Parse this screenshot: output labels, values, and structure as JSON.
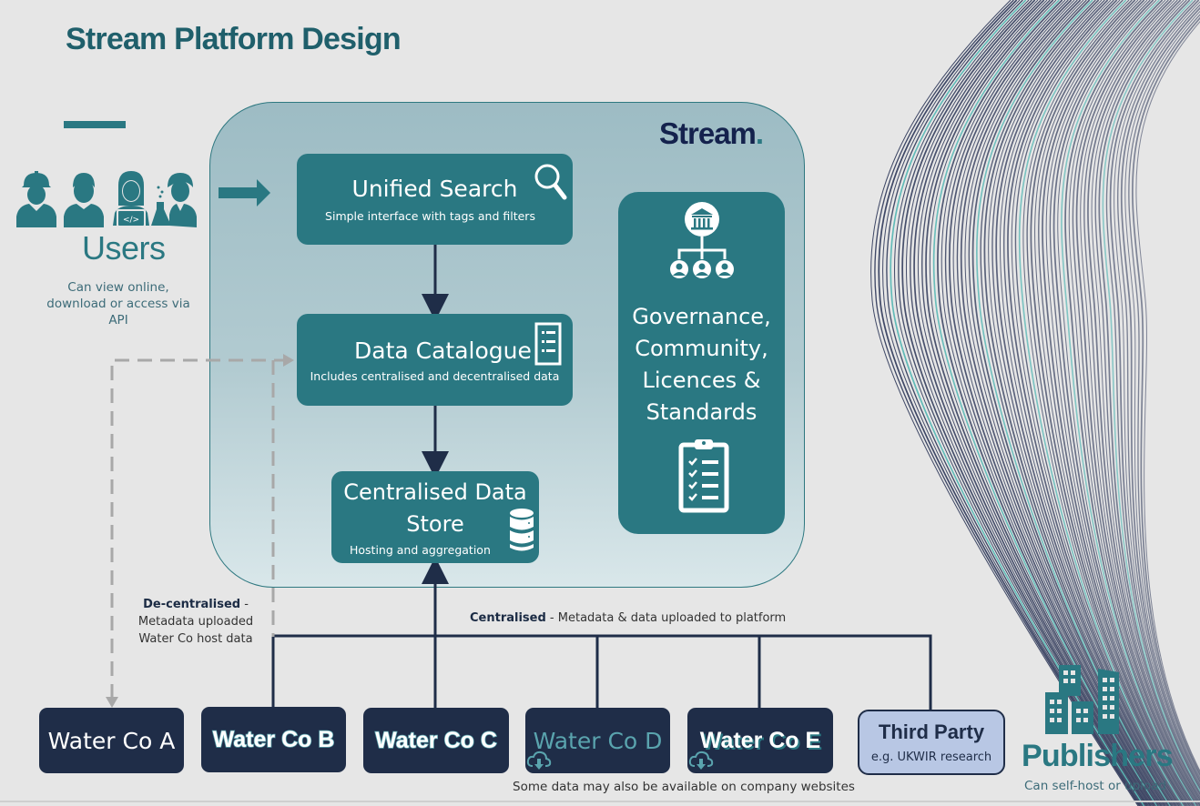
{
  "page": {
    "title": "Stream Platform Design"
  },
  "platform": {
    "logo": "Stream",
    "logo_dot": ".",
    "unified_search": {
      "title": "Unified Search",
      "subtitle": "Simple interface with tags and filters",
      "icon": "magnifier-icon"
    },
    "data_catalogue": {
      "title": "Data Catalogue",
      "subtitle": "Includes centralised and decentralised data",
      "icon": "list-document-icon"
    },
    "data_store": {
      "title_line1": "Centralised Data",
      "title_line2": "Store",
      "subtitle": "Hosting and aggregation",
      "icon": "database-icon"
    },
    "governance": {
      "title": "Governance, Community, Licences & Standards",
      "icons": [
        "institution-hierarchy-icon",
        "clipboard-checklist-icon"
      ]
    }
  },
  "users": {
    "label": "Users",
    "subtitle": "Can view online, download or access via API",
    "icons": [
      "engineer-icon",
      "businessman-icon",
      "developer-icon",
      "scientist-icon"
    ]
  },
  "flows": {
    "decentralised": {
      "label_bold": "De-centralised",
      "label_rest": " - Metadata uploaded Water Co host data"
    },
    "centralised": {
      "label_bold": "Centralised",
      "label_rest": " - Metadata & data uploaded to platform"
    }
  },
  "publishers": {
    "label": "Publishers",
    "subtitle": "Can self-host or upload",
    "items": [
      {
        "name": "Water Co A",
        "style": "plain",
        "cloud_icon": false
      },
      {
        "name": "Water Co B",
        "style": "outlined",
        "cloud_icon": false
      },
      {
        "name": "Water Co C",
        "style": "outlined",
        "cloud_icon": false
      },
      {
        "name": "Water Co D",
        "style": "ghost",
        "cloud_icon": true
      },
      {
        "name": "Water Co E",
        "style": "bold",
        "cloud_icon": true
      }
    ],
    "third_party": {
      "title": "Third Party",
      "subtitle": "e.g. UKWIR research"
    },
    "websites_note": "Some data may also be available on company websites"
  },
  "colors": {
    "teal": "#2a7882",
    "navy": "#1f2d48",
    "panel": "#9dbcc4",
    "third_party": "#b8c7e4",
    "background": "#e6e6e6",
    "dashed": "#a8a8a8"
  }
}
